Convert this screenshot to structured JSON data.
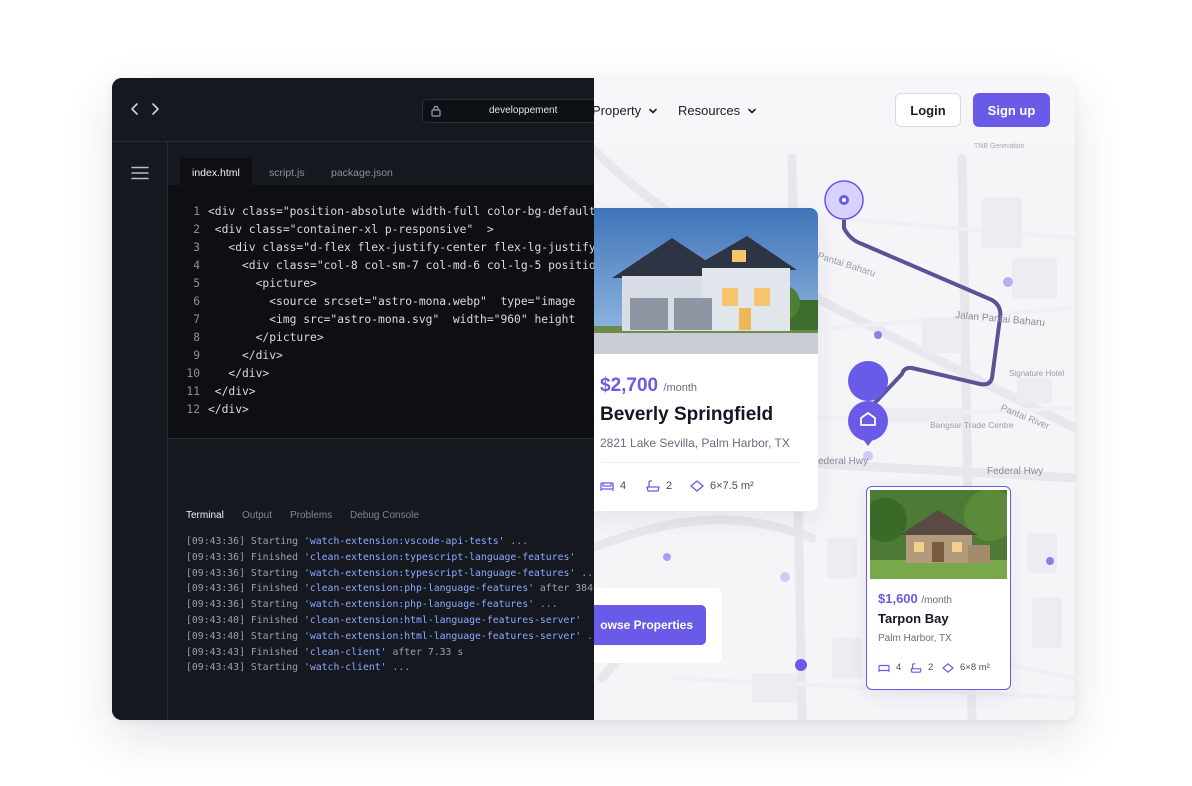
{
  "editor": {
    "url": "developpement",
    "tabs": [
      "index.html",
      "script.js",
      "package.json"
    ],
    "code_lines": [
      {
        "n": "1",
        "text": "<div class=\"position-absolute width-full color-bg-default"
      },
      {
        "n": "2",
        "text": " <div class=\"container-xl p-responsive\"  >"
      },
      {
        "n": "3",
        "text": "   <div class=\"d-flex flex-justify-center flex-lg-justify"
      },
      {
        "n": "4",
        "text": "     <div class=\"col-8 col-sm-7 col-md-6 col-lg-5 position"
      },
      {
        "n": "5",
        "text": "       <picture>"
      },
      {
        "n": "6",
        "text": "         <source srcset=\"astro-mona.webp\"  type=\"image"
      },
      {
        "n": "7",
        "text": "         <img src=\"astro-mona.svg\"  width=\"960\" height"
      },
      {
        "n": "8",
        "text": "       </picture>"
      },
      {
        "n": "9",
        "text": "     </div>"
      },
      {
        "n": "10",
        "text": "   </div>"
      },
      {
        "n": "11",
        "text": " </div>"
      },
      {
        "n": "12",
        "text": "</div>"
      }
    ],
    "panel_tabs": [
      "Terminal",
      "Output",
      "Problems",
      "Debug Console"
    ],
    "terminal_lines": [
      {
        "time": "[09:43:36]",
        "verb": " Starting ",
        "task": "'watch-extension:vscode-api-tests'",
        "rest": " ..."
      },
      {
        "time": "[09:43:36]",
        "verb": " Finished ",
        "task": "'clean-extension:typescript-language-features'",
        "rest": ""
      },
      {
        "time": "[09:43:36]",
        "verb": " Starting ",
        "task": "'watch-extension:typescript-language-features'",
        "rest": " ..."
      },
      {
        "time": "[09:43:36]",
        "verb": " Finished ",
        "task": "'clean-extension:php-language-features'",
        "rest": " after 384"
      },
      {
        "time": "[09:43:36]",
        "verb": " Starting ",
        "task": "'watch-extension:php-language-features'",
        "rest": " ..."
      },
      {
        "time": "[09:43:40]",
        "verb": " Finished ",
        "task": "'clean-extension:html-language-features-server'",
        "rest": ""
      },
      {
        "time": "[09:43:40]",
        "verb": " Starting ",
        "task": "'watch-extension:html-language-features-server'",
        "rest": " ..."
      },
      {
        "time": "[09:43:43]",
        "verb": " Finished ",
        "task": "'clean-client'",
        "rest": " after 7.33 s"
      },
      {
        "time": "[09:43:43]",
        "verb": " Starting ",
        "task": "'watch-client'",
        "rest": " ..."
      }
    ]
  },
  "site": {
    "nav": {
      "property": "Property",
      "resources": "Resources",
      "login": "Login",
      "signup": "Sign up"
    },
    "map_labels": {
      "jalan_pantai_baharu": "Jalan Pantai Baharu",
      "pantai_baharu": "Pantai Baharu",
      "signature_hotel": "Signature Hotel",
      "pantai_river": "Pantai River",
      "bangsar_trade": "Bangsar Trade Centre",
      "federal_hwy": "Federal Hwy",
      "federal_hwy_2": "Federal Hwy",
      "tnb": "TNB Generation"
    },
    "card_main": {
      "price": "$2,700",
      "per": "/month",
      "name": "Beverly Springfield",
      "address": "2821 Lake Sevilla, Palm Harbor, TX",
      "beds": "4",
      "baths": "2",
      "area": "6×7.5 m²"
    },
    "card_small": {
      "price": "$1,600",
      "per": "/month",
      "name": "Tarpon Bay",
      "address": "Palm Harbor, TX",
      "beds": "4",
      "baths": "2",
      "area": "6×8 m²"
    },
    "browse_button": "owse Properties",
    "colors": {
      "accent": "#6a5ae8",
      "editor_bg": "#15181f",
      "code_bg": "#0d0f13"
    }
  }
}
